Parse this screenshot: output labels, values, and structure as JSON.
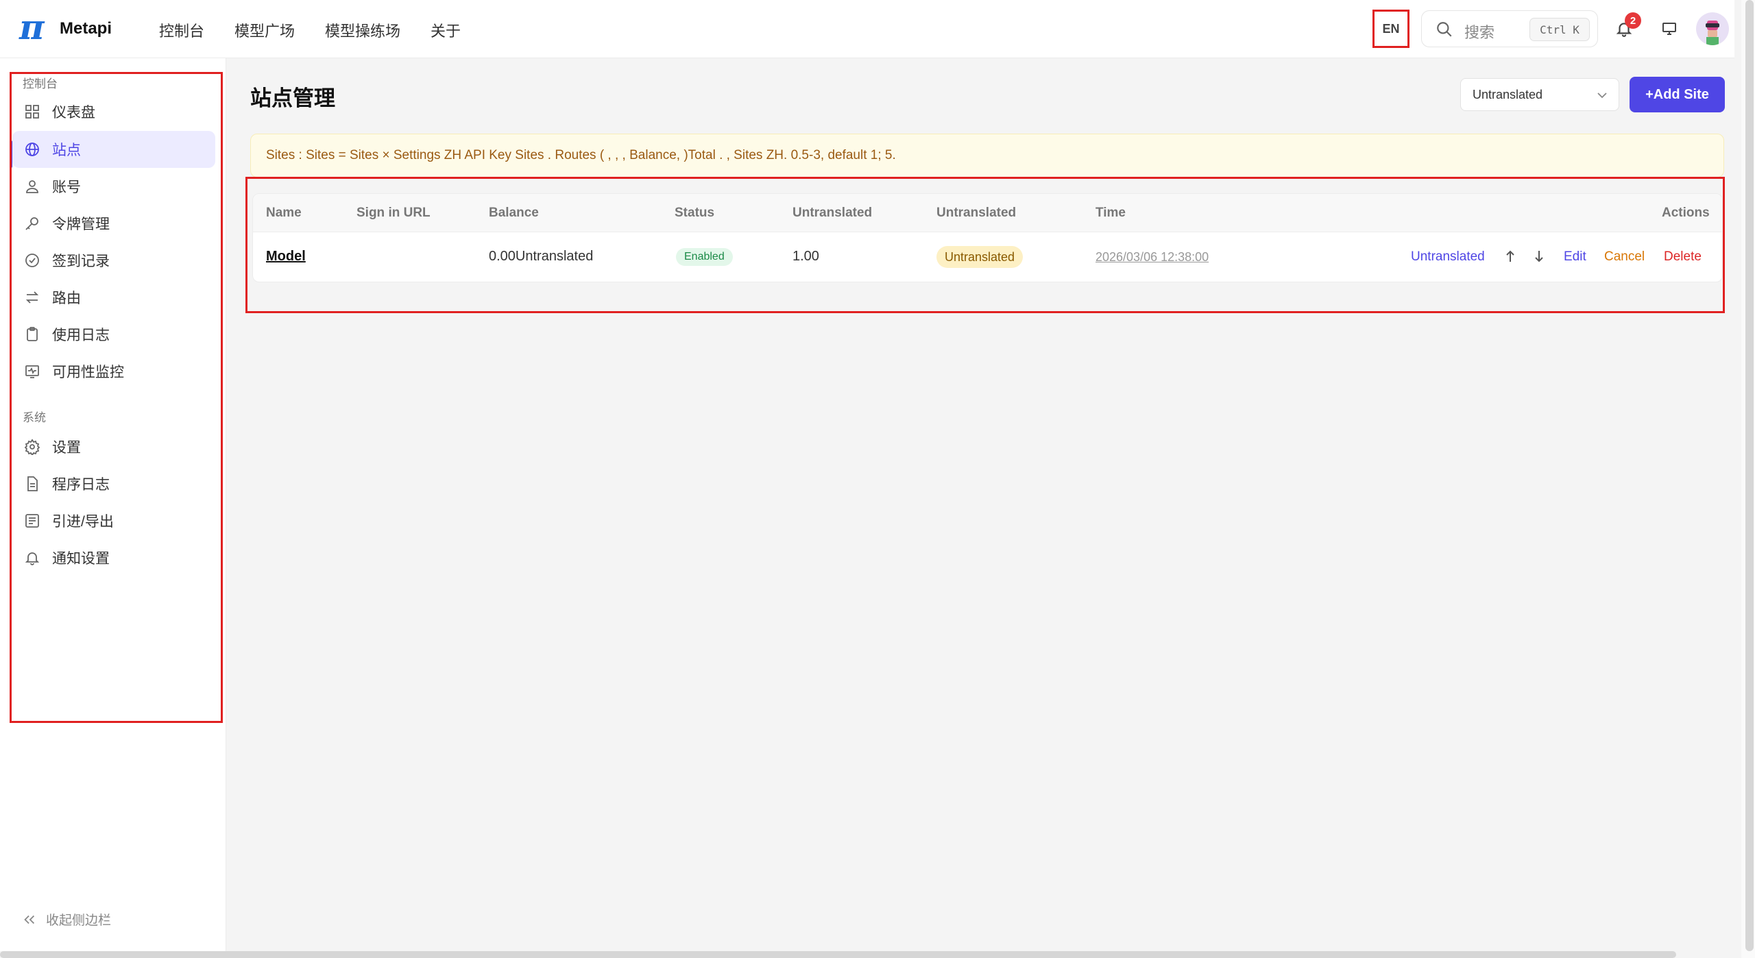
{
  "brand": {
    "logo_glyph": "π",
    "name": "Metapi"
  },
  "top_nav": [
    "控制台",
    "模型广场",
    "模型操练场",
    "关于"
  ],
  "header": {
    "lang": "EN",
    "search_placeholder": "搜索",
    "search_shortcut": "Ctrl K",
    "notification_count": "2"
  },
  "sidebar": {
    "section_console": "控制台",
    "items_console": [
      {
        "label": "仪表盘",
        "icon": "dashboard-icon"
      },
      {
        "label": "站点",
        "icon": "globe-icon",
        "active": true
      },
      {
        "label": "账号",
        "icon": "user-icon"
      },
      {
        "label": "令牌管理",
        "icon": "key-icon"
      },
      {
        "label": "签到记录",
        "icon": "check-circle-icon"
      },
      {
        "label": "路由",
        "icon": "swap-icon"
      },
      {
        "label": "使用日志",
        "icon": "clipboard-icon"
      },
      {
        "label": "可用性监控",
        "icon": "monitor-pulse-icon"
      }
    ],
    "section_system": "系统",
    "items_system": [
      {
        "label": "设置",
        "icon": "gear-icon"
      },
      {
        "label": "程序日志",
        "icon": "file-icon"
      },
      {
        "label": "引进/导出",
        "icon": "list-icon"
      },
      {
        "label": "通知设置",
        "icon": "bell-icon"
      }
    ],
    "collapse_label": "收起侧边栏"
  },
  "main": {
    "title": "站点管理",
    "select_value": "Untranslated",
    "add_button": "+Add Site",
    "notice": "Sites : Sites = Sites × Settings ZH API Key Sites . Routes ( , , , Balance, )Total . , Sites ZH. 0.5-3, default 1; 5.",
    "table": {
      "headers": [
        "Name",
        "Sign in URL",
        "Balance",
        "Status",
        "Untranslated",
        "Untranslated",
        "Time",
        "Actions"
      ],
      "rows": [
        {
          "name": "Model",
          "url": "",
          "balance": "0.00Untranslated",
          "status": "Enabled",
          "multiplier": "1.00",
          "tag": "Untranslated",
          "time": "2026/03/06 12:38:00",
          "actions": {
            "untranslated": "Untranslated",
            "edit": "Edit",
            "cancel": "Cancel",
            "delete": "Delete"
          }
        }
      ]
    }
  },
  "colors": {
    "accent": "#4f46e5",
    "highlight": "#e02020",
    "success": "#1b8a47",
    "warning": "#8a5a00",
    "danger": "#e5383b"
  }
}
